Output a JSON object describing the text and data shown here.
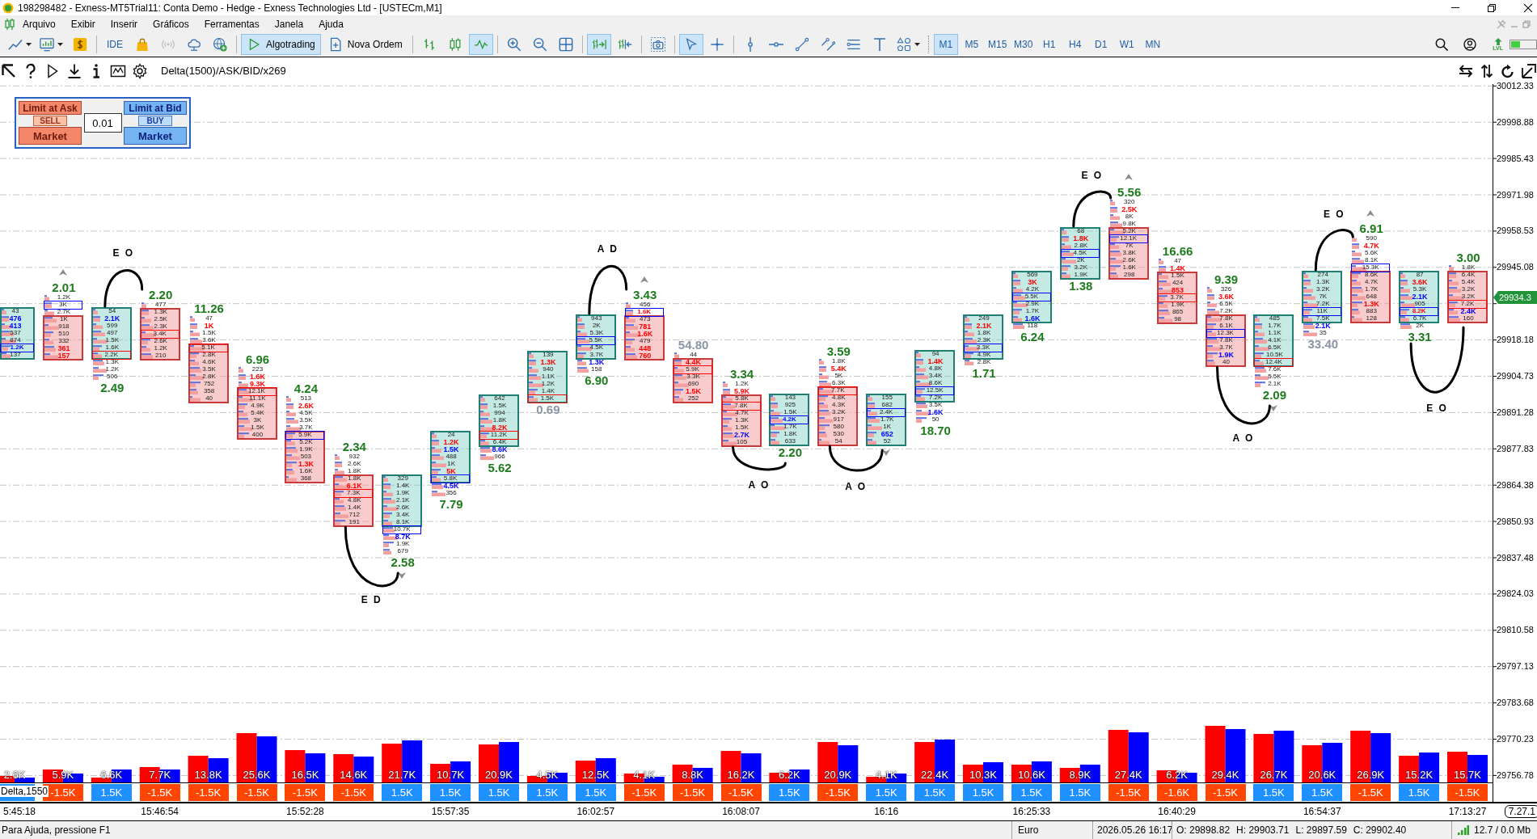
{
  "window": {
    "title": "198298482 - Exness-MT5Trial11: Conta Demo - Hedge - Exness Technologies Ltd - [USTECm,M1]"
  },
  "menu": [
    "Arquivo",
    "Exibir",
    "Inserir",
    "Gráficos",
    "Ferramentas",
    "Janela",
    "Ajuda"
  ],
  "toolbar": {
    "groups": [
      [
        {
          "selected": false
        },
        {
          "selected": false
        },
        {
          "selected": false
        }
      ],
      [
        {
          "label": "IDE",
          "selected": false
        },
        {
          "selected": false
        },
        {
          "selected": false
        },
        {
          "selected": false
        },
        {
          "selected": false
        }
      ],
      [
        {
          "label": "Algotrading",
          "selected": true
        },
        {
          "label": "Nova Ordem",
          "selected": false
        }
      ],
      [
        {
          "selected": false
        },
        {
          "selected": false
        },
        {
          "selected": true
        }
      ],
      [
        {
          "selected": false
        },
        {
          "selected": false
        },
        {
          "selected": false
        }
      ],
      [
        {
          "selected": true
        },
        {
          "selected": false
        }
      ],
      [
        {
          "selected": false
        }
      ],
      [
        {
          "selected": true
        },
        {
          "selected": false
        }
      ],
      [
        {
          "selected": false
        },
        {
          "selected": false
        },
        {
          "selected": false
        },
        {
          "selected": false
        },
        {
          "selected": false
        },
        {
          "selected": false
        },
        {
          "selected": false
        }
      ]
    ],
    "timeframes": [
      {
        "label": "M1",
        "selected": true
      },
      {
        "label": "M5",
        "selected": false
      },
      {
        "label": "M15",
        "selected": false
      },
      {
        "label": "M30",
        "selected": false
      },
      {
        "label": "H1",
        "selected": false
      },
      {
        "label": "H4",
        "selected": false
      },
      {
        "label": "D1",
        "selected": false
      },
      {
        "label": "W1",
        "selected": false
      },
      {
        "label": "MN",
        "selected": false
      }
    ],
    "badge": "LVL"
  },
  "chart": {
    "indicator_label": "Delta(1500)/ASK/BID/x269",
    "trade_panel": {
      "sides": [
        {
          "kind": "sell",
          "limit": "Limit at Ask",
          "action": "SELL",
          "market": "Market"
        },
        {
          "kind": "buy",
          "limit": "Limit at Bid",
          "action": "BUY",
          "market": "Market"
        }
      ],
      "volume": "0.01"
    },
    "price_axis": [
      "30012.33",
      "29998.88",
      "29985.43",
      "29971.98",
      "29958.53",
      "29945.08",
      "29918.18",
      "29904.73",
      "29891.28",
      "29877.83",
      "29864.38",
      "29850.93",
      "29837.48",
      "29824.03",
      "29810.58",
      "29797.13",
      "29783.68",
      "29770.23",
      "29756.78"
    ],
    "current_price": "29934.3",
    "candles": [
      {
        "kind": "bullish",
        "body": [
          {
            "text": "43",
            "kind": "plain"
          },
          {
            "text": "476",
            "kind": "buy"
          },
          {
            "text": "413",
            "kind": "buy"
          },
          {
            "text": "537",
            "kind": "plain"
          },
          {
            "text": "874",
            "kind": "plain"
          },
          {
            "text": "1.2K",
            "kind": "buy",
            "frame": {
              "color": "#0000ff"
            }
          },
          {
            "text": "137",
            "kind": "plain"
          }
        ]
      },
      {
        "kind": "bearish",
        "above": [
          {
            "text": "1.2K",
            "kind": "plain"
          },
          {
            "text": "3K",
            "kind": "plain",
            "frame": {
              "color": "#0000ff"
            }
          },
          {
            "text": "2.7K",
            "kind": "plain"
          }
        ],
        "body": [
          {
            "text": "1K",
            "kind": "plain"
          },
          {
            "text": "918",
            "kind": "plain"
          },
          {
            "text": "510",
            "kind": "plain"
          },
          {
            "text": "332",
            "kind": "plain"
          },
          {
            "text": "361",
            "kind": "sell"
          },
          {
            "text": "157",
            "kind": "sell"
          }
        ],
        "delta": {
          "text": "2.01",
          "color": "#1e7b1e"
        },
        "arrow": {
          "kind": "up"
        }
      },
      {
        "kind": "bullish",
        "body": [
          {
            "text": "54",
            "kind": "plain"
          },
          {
            "text": "2.1K",
            "kind": "buy"
          },
          {
            "text": "599",
            "kind": "plain"
          },
          {
            "text": "497",
            "kind": "plain"
          },
          {
            "text": "1.5K",
            "kind": "plain"
          },
          {
            "text": "1.6K",
            "kind": "plain"
          },
          {
            "text": "2.2K",
            "kind": "plain",
            "frame": {
              "color": "#ff0000"
            }
          }
        ],
        "below": [
          {
            "text": "1.3K",
            "kind": "plain"
          },
          {
            "text": "1.2K",
            "kind": "plain"
          },
          {
            "text": "506",
            "kind": "plain"
          }
        ],
        "delta": {
          "text": "2.49",
          "color": "#1e7b1e"
        },
        "curve": {
          "label": "E O",
          "kind": "above"
        }
      },
      {
        "kind": "bearish",
        "above": [
          {
            "text": "477",
            "kind": "plain"
          }
        ],
        "body": [
          {
            "text": "1.3K",
            "kind": "plain"
          },
          {
            "text": "2.5K",
            "kind": "plain"
          },
          {
            "text": "2.3K",
            "kind": "plain"
          },
          {
            "text": "3.4K",
            "kind": "plain",
            "frame": {
              "color": "#ff0000"
            }
          },
          {
            "text": "2.6K",
            "kind": "plain"
          },
          {
            "text": "1.2K",
            "kind": "plain"
          },
          {
            "text": "210",
            "kind": "plain"
          }
        ],
        "delta": {
          "text": "2.20",
          "color": "#1e7b1e"
        }
      },
      {
        "kind": "bearish",
        "above": [
          {
            "text": "47",
            "kind": "plain"
          },
          {
            "text": "1K",
            "kind": "sell"
          },
          {
            "text": "1.5K",
            "kind": "plain"
          },
          {
            "text": "3.6K",
            "kind": "plain"
          }
        ],
        "body": [
          {
            "text": "5.1K",
            "kind": "plain",
            "frame": {
              "color": "#ff0000"
            }
          },
          {
            "text": "2.8K",
            "kind": "plain"
          },
          {
            "text": "4.6K",
            "kind": "plain"
          },
          {
            "text": "3.5K",
            "kind": "plain"
          },
          {
            "text": "2.8K",
            "kind": "plain"
          },
          {
            "text": "752",
            "kind": "plain"
          },
          {
            "text": "358",
            "kind": "plain"
          },
          {
            "text": "40",
            "kind": "plain"
          }
        ],
        "delta": {
          "text": "11.26",
          "color": "#1e7b1e"
        }
      },
      {
        "kind": "bearish",
        "above": [
          {
            "text": "223",
            "kind": "plain"
          },
          {
            "text": "1.6K",
            "kind": "sell"
          },
          {
            "text": "9.3K",
            "kind": "sell"
          }
        ],
        "body": [
          {
            "text": "12.1K",
            "kind": "plain",
            "frame": {
              "color": "#ff0000"
            }
          },
          {
            "text": "11.1K",
            "kind": "plain"
          },
          {
            "text": "4.9K",
            "kind": "plain"
          },
          {
            "text": "5.4K",
            "kind": "plain"
          },
          {
            "text": "3K",
            "kind": "plain"
          },
          {
            "text": "1.5K",
            "kind": "plain"
          },
          {
            "text": "400",
            "kind": "plain"
          }
        ],
        "delta": {
          "text": "6.96",
          "color": "#1e7b1e"
        }
      },
      {
        "kind": "bearish",
        "above": [
          {
            "text": "513",
            "kind": "plain"
          },
          {
            "text": "2.6K",
            "kind": "sell"
          },
          {
            "text": "4.5K",
            "kind": "plain"
          },
          {
            "text": "3.5K",
            "kind": "plain"
          },
          {
            "text": "3.7K",
            "kind": "plain"
          }
        ],
        "body": [
          {
            "text": "5.9K",
            "kind": "plain",
            "frame": {
              "color": "#0000ff"
            }
          },
          {
            "text": "5.2K",
            "kind": "plain"
          },
          {
            "text": "1.9K",
            "kind": "plain"
          },
          {
            "text": "503",
            "kind": "plain"
          },
          {
            "text": "1.3K",
            "kind": "sell"
          },
          {
            "text": "1.6K",
            "kind": "plain"
          },
          {
            "text": "368",
            "kind": "plain"
          }
        ],
        "delta": {
          "text": "4.24",
          "color": "#1e7b1e"
        }
      },
      {
        "kind": "bearish",
        "above": [
          {
            "text": "932",
            "kind": "plain"
          },
          {
            "text": "2.6K",
            "kind": "plain"
          },
          {
            "text": "1.8K",
            "kind": "plain"
          }
        ],
        "body": [
          {
            "text": "1.8K",
            "kind": "plain"
          },
          {
            "text": "6.1K",
            "kind": "sell"
          },
          {
            "text": "7.3K",
            "kind": "plain",
            "frame": {
              "color": "#ff0000"
            }
          },
          {
            "text": "4.8K",
            "kind": "plain"
          },
          {
            "text": "1.4K",
            "kind": "plain"
          },
          {
            "text": "712",
            "kind": "plain"
          },
          {
            "text": "191",
            "kind": "plain"
          }
        ],
        "delta": {
          "text": "2.34",
          "color": "#1e7b1e"
        },
        "curve": {
          "label": "E D",
          "kind": "below"
        }
      },
      {
        "kind": "bullish",
        "body": [
          {
            "text": "329",
            "kind": "plain"
          },
          {
            "text": "1.4K",
            "kind": "plain"
          },
          {
            "text": "1.9K",
            "kind": "plain"
          },
          {
            "text": "2.1K",
            "kind": "plain"
          },
          {
            "text": "2.6K",
            "kind": "plain"
          },
          {
            "text": "3.4K",
            "kind": "plain"
          },
          {
            "text": "8.1K",
            "kind": "plain"
          }
        ],
        "below": [
          {
            "text": "10.7K",
            "kind": "plain",
            "frame": {
              "color": "#0000ff"
            }
          },
          {
            "text": "8.7K",
            "kind": "buy"
          },
          {
            "text": "1.9K",
            "kind": "plain"
          },
          {
            "text": "679",
            "kind": "plain"
          }
        ],
        "delta": {
          "text": "2.58",
          "color": "#1e7b1e"
        },
        "arrow": {
          "kind": "down"
        }
      },
      {
        "kind": "bullish",
        "body": [
          {
            "text": "24",
            "kind": "plain"
          },
          {
            "text": "1.2K",
            "kind": "sell"
          },
          {
            "text": "1.5K",
            "kind": "buy"
          },
          {
            "text": "488",
            "kind": "plain"
          },
          {
            "text": "1K",
            "kind": "plain"
          },
          {
            "text": "5K",
            "kind": "sell"
          },
          {
            "text": "5.8K",
            "kind": "plain",
            "frame": {
              "color": "#0000ff"
            }
          }
        ],
        "below": [
          {
            "text": "4.5K",
            "kind": "buy"
          },
          {
            "text": "356",
            "kind": "plain"
          }
        ],
        "delta": {
          "text": "7.79",
          "color": "#1e7b1e"
        }
      },
      {
        "kind": "bullish",
        "body": [
          {
            "text": "642",
            "kind": "plain"
          },
          {
            "text": "1.5K",
            "kind": "plain"
          },
          {
            "text": "994",
            "kind": "plain"
          },
          {
            "text": "1.8K",
            "kind": "plain"
          },
          {
            "text": "8.2K",
            "kind": "sell"
          },
          {
            "text": "11.2K",
            "kind": "plain",
            "frame": {
              "color": "#ff0000"
            }
          },
          {
            "text": "6.4K",
            "kind": "plain"
          }
        ],
        "below": [
          {
            "text": "8.6K",
            "kind": "buy"
          },
          {
            "text": "966",
            "kind": "plain"
          }
        ],
        "delta": {
          "text": "5.62",
          "color": "#1e7b1e"
        }
      },
      {
        "kind": "bullish",
        "body": [
          {
            "text": "139",
            "kind": "plain"
          },
          {
            "text": "1.3K",
            "kind": "sell"
          },
          {
            "text": "940",
            "kind": "plain"
          },
          {
            "text": "1.1K",
            "kind": "plain"
          },
          {
            "text": "1.2K",
            "kind": "plain"
          },
          {
            "text": "1.4K",
            "kind": "plain"
          },
          {
            "text": "1.5K",
            "kind": "plain",
            "frame": {
              "color": "#ff0000"
            }
          }
        ],
        "delta": {
          "text": "0.69",
          "color": "#8a95a5"
        }
      },
      {
        "kind": "bullish",
        "body": [
          {
            "text": "943",
            "kind": "plain"
          },
          {
            "text": "2K",
            "kind": "plain"
          },
          {
            "text": "5.3K",
            "kind": "plain"
          },
          {
            "text": "5.5K",
            "kind": "plain",
            "frame": {
              "color": "#0000ff"
            }
          },
          {
            "text": "4.5K",
            "kind": "plain"
          },
          {
            "text": "3.7K",
            "kind": "plain"
          }
        ],
        "below": [
          {
            "text": "1.3K",
            "kind": "buy"
          },
          {
            "text": "158",
            "kind": "plain"
          }
        ],
        "delta": {
          "text": "6.90",
          "color": "#1e7b1e"
        },
        "curve": {
          "label": "A D",
          "kind": "above"
        }
      },
      {
        "kind": "bearish",
        "above": [
          {
            "text": "456",
            "kind": "plain"
          },
          {
            "text": "1.6K",
            "kind": "sell",
            "frame": {
              "color": "#0000ff"
            }
          }
        ],
        "body": [
          {
            "text": "473",
            "kind": "plain"
          },
          {
            "text": "781",
            "kind": "sell"
          },
          {
            "text": "1.6K",
            "kind": "sell"
          },
          {
            "text": "479",
            "kind": "plain"
          },
          {
            "text": "448",
            "kind": "sell"
          },
          {
            "text": "760",
            "kind": "sell"
          }
        ],
        "delta": {
          "text": "3.43",
          "color": "#1e7b1e"
        },
        "arrow": {
          "kind": "up"
        }
      },
      {
        "kind": "bearish",
        "above": [
          {
            "text": "44",
            "kind": "plain"
          }
        ],
        "body": [
          {
            "text": "4.4K",
            "kind": "sell"
          },
          {
            "text": "5.9K",
            "kind": "plain",
            "frame": {
              "color": "#ff0000"
            }
          },
          {
            "text": "3.3K",
            "kind": "plain"
          },
          {
            "text": "690",
            "kind": "plain"
          },
          {
            "text": "1.5K",
            "kind": "sell"
          },
          {
            "text": "252",
            "kind": "plain"
          }
        ],
        "delta": {
          "text": "54.80",
          "color": "#8a95a5"
        }
      },
      {
        "kind": "bearish",
        "above": [
          {
            "text": "1.2K",
            "kind": "plain"
          },
          {
            "text": "5.9K",
            "kind": "sell"
          }
        ],
        "body": [
          {
            "text": "5.8K",
            "kind": "plain"
          },
          {
            "text": "7.8K",
            "kind": "plain",
            "frame": {
              "color": "#ff0000"
            }
          },
          {
            "text": "4.7K",
            "kind": "plain"
          },
          {
            "text": "1.3K",
            "kind": "plain"
          },
          {
            "text": "1.5K",
            "kind": "plain"
          },
          {
            "text": "2.7K",
            "kind": "buy"
          },
          {
            "text": "105",
            "kind": "plain"
          }
        ],
        "delta": {
          "text": "3.34",
          "color": "#1e7b1e"
        },
        "curve": {
          "label": "A O",
          "kind": "below"
        }
      },
      {
        "kind": "bullish",
        "body": [
          {
            "text": "143",
            "kind": "plain"
          },
          {
            "text": "925",
            "kind": "plain"
          },
          {
            "text": "1.5K",
            "kind": "plain"
          },
          {
            "text": "4.2K",
            "kind": "buy",
            "frame": {
              "color": "#0000ff"
            }
          },
          {
            "text": "1.7K",
            "kind": "plain"
          },
          {
            "text": "1.8K",
            "kind": "plain"
          },
          {
            "text": "633",
            "kind": "plain"
          }
        ],
        "delta": {
          "text": "2.20",
          "color": "#1e7b1e"
        }
      },
      {
        "kind": "bearish",
        "above": [
          {
            "text": "1.8K",
            "kind": "plain"
          },
          {
            "text": "5.4K",
            "kind": "sell"
          },
          {
            "text": "5K",
            "kind": "plain"
          },
          {
            "text": "6.3K",
            "kind": "plain"
          }
        ],
        "body": [
          {
            "text": "7.7K",
            "kind": "plain",
            "frame": {
              "color": "#ff0000"
            }
          },
          {
            "text": "4.8K",
            "kind": "plain"
          },
          {
            "text": "4.3K",
            "kind": "plain"
          },
          {
            "text": "3.2K",
            "kind": "plain"
          },
          {
            "text": "917",
            "kind": "plain"
          },
          {
            "text": "580",
            "kind": "plain"
          },
          {
            "text": "530",
            "kind": "plain"
          },
          {
            "text": "54",
            "kind": "plain"
          }
        ],
        "delta": {
          "text": "3.59",
          "color": "#1e7b1e"
        },
        "curve": {
          "label": "A O",
          "kind": "below"
        }
      },
      {
        "kind": "bullish",
        "body": [
          {
            "text": "155",
            "kind": "plain"
          },
          {
            "text": "682",
            "kind": "plain"
          },
          {
            "text": "2.4K",
            "kind": "plain",
            "frame": {
              "color": "#0000ff"
            }
          },
          {
            "text": "1.7K",
            "kind": "plain"
          },
          {
            "text": "1K",
            "kind": "plain"
          },
          {
            "text": "652",
            "kind": "buy"
          },
          {
            "text": "52",
            "kind": "plain"
          }
        ],
        "arrow": {
          "kind": "down"
        }
      },
      {
        "kind": "bullish",
        "body": [
          {
            "text": "94",
            "kind": "plain"
          },
          {
            "text": "1.4K",
            "kind": "sell"
          },
          {
            "text": "4.8K",
            "kind": "plain"
          },
          {
            "text": "3.4K",
            "kind": "plain"
          },
          {
            "text": "8.6K",
            "kind": "plain"
          },
          {
            "text": "12.5K",
            "kind": "plain",
            "frame": {
              "color": "#0000ff"
            }
          },
          {
            "text": "7.2K",
            "kind": "plain"
          }
        ],
        "below": [
          {
            "text": "3.5K",
            "kind": "plain"
          },
          {
            "text": "1.6K",
            "kind": "buy"
          },
          {
            "text": "50",
            "kind": "plain"
          }
        ],
        "delta": {
          "text": "18.70",
          "color": "#1e7b1e"
        }
      },
      {
        "kind": "bullish",
        "body": [
          {
            "text": "249",
            "kind": "plain"
          },
          {
            "text": "2.1K",
            "kind": "sell"
          },
          {
            "text": "1.8K",
            "kind": "plain"
          },
          {
            "text": "2.3K",
            "kind": "plain"
          },
          {
            "text": "3.3K",
            "kind": "plain",
            "frame": {
              "color": "#0000ff"
            }
          },
          {
            "text": "4.9K",
            "kind": "plain"
          }
        ],
        "below": [
          {
            "text": "2.8K",
            "kind": "plain"
          }
        ],
        "delta": {
          "text": "1.71",
          "color": "#1e7b1e"
        }
      },
      {
        "kind": "bullish",
        "body": [
          {
            "text": "569",
            "kind": "plain"
          },
          {
            "text": "3K",
            "kind": "sell"
          },
          {
            "text": "4.2K",
            "kind": "plain"
          },
          {
            "text": "5.5K",
            "kind": "plain",
            "frame": {
              "color": "#0000ff"
            }
          },
          {
            "text": "2.9K",
            "kind": "plain"
          },
          {
            "text": "1.7K",
            "kind": "plain"
          },
          {
            "text": "1.6K",
            "kind": "buy"
          }
        ],
        "below": [
          {
            "text": "118",
            "kind": "plain"
          }
        ],
        "delta": {
          "text": "6.24",
          "color": "#1e7b1e"
        }
      },
      {
        "kind": "bullish",
        "body": [
          {
            "text": "68",
            "kind": "plain"
          },
          {
            "text": "1.8K",
            "kind": "sell"
          },
          {
            "text": "2.8K",
            "kind": "plain"
          },
          {
            "text": "4.5K",
            "kind": "plain",
            "frame": {
              "color": "#0000ff"
            }
          },
          {
            "text": "2K",
            "kind": "plain"
          },
          {
            "text": "3.2K",
            "kind": "plain"
          },
          {
            "text": "1.9K",
            "kind": "plain"
          }
        ],
        "delta": {
          "text": "1.38",
          "color": "#1e7b1e"
        },
        "curve": {
          "label": "E O",
          "kind": "above"
        }
      },
      {
        "kind": "bearish",
        "above": [
          {
            "text": "320",
            "kind": "plain"
          },
          {
            "text": "2.5K",
            "kind": "sell"
          },
          {
            "text": "8K",
            "kind": "plain"
          },
          {
            "text": "9.8K",
            "kind": "plain"
          }
        ],
        "body": [
          {
            "text": "5.2K",
            "kind": "plain"
          },
          {
            "text": "12.1K",
            "kind": "plain",
            "frame": {
              "color": "#0000ff"
            }
          },
          {
            "text": "7K",
            "kind": "plain"
          },
          {
            "text": "3.8K",
            "kind": "plain"
          },
          {
            "text": "2.6K",
            "kind": "plain"
          },
          {
            "text": "1.6K",
            "kind": "plain"
          },
          {
            "text": "298",
            "kind": "plain"
          }
        ],
        "delta": {
          "text": "5.56",
          "color": "#1e7b1e"
        },
        "arrow": {
          "kind": "up"
        }
      },
      {
        "kind": "bearish",
        "above": [
          {
            "text": "47",
            "kind": "plain"
          },
          {
            "text": "1.4K",
            "kind": "sell"
          }
        ],
        "body": [
          {
            "text": "1.5K",
            "kind": "plain"
          },
          {
            "text": "424",
            "kind": "plain"
          },
          {
            "text": "853",
            "kind": "sell"
          },
          {
            "text": "3.7K",
            "kind": "plain",
            "frame": {
              "color": "#ff0000"
            }
          },
          {
            "text": "1.9K",
            "kind": "plain"
          },
          {
            "text": "865",
            "kind": "plain"
          },
          {
            "text": "98",
            "kind": "plain"
          }
        ],
        "delta": {
          "text": "16.66",
          "color": "#1e7b1e"
        }
      },
      {
        "kind": "bearish",
        "above": [
          {
            "text": "326",
            "kind": "plain"
          },
          {
            "text": "3.6K",
            "kind": "sell"
          },
          {
            "text": "6.5K",
            "kind": "plain"
          },
          {
            "text": "7.2K",
            "kind": "plain"
          }
        ],
        "body": [
          {
            "text": "7.8K",
            "kind": "plain"
          },
          {
            "text": "6.1K",
            "kind": "plain"
          },
          {
            "text": "12.3K",
            "kind": "plain",
            "frame": {
              "color": "#0000ff"
            }
          },
          {
            "text": "7.8K",
            "kind": "plain"
          },
          {
            "text": "3.7K",
            "kind": "plain"
          },
          {
            "text": "1.9K",
            "kind": "buy"
          },
          {
            "text": "40",
            "kind": "plain"
          }
        ],
        "delta": {
          "text": "9.39",
          "color": "#1e7b1e"
        },
        "curve": {
          "label": "A O",
          "kind": "below"
        }
      },
      {
        "kind": "bullish",
        "body": [
          {
            "text": "485",
            "kind": "plain"
          },
          {
            "text": "1.7K",
            "kind": "plain"
          },
          {
            "text": "1.1K",
            "kind": "plain"
          },
          {
            "text": "4.1K",
            "kind": "plain"
          },
          {
            "text": "6.5K",
            "kind": "plain"
          },
          {
            "text": "10.5K",
            "kind": "plain"
          },
          {
            "text": "12.4K",
            "kind": "plain",
            "frame": {
              "color": "#ff0000"
            }
          }
        ],
        "below": [
          {
            "text": "7.6K",
            "kind": "plain"
          },
          {
            "text": "5.5K",
            "kind": "plain"
          },
          {
            "text": "2.1K",
            "kind": "plain"
          }
        ],
        "delta": {
          "text": "2.09",
          "color": "#1e7b1e"
        },
        "arrow": {
          "kind": "down"
        }
      },
      {
        "kind": "bullish",
        "body": [
          {
            "text": "274",
            "kind": "plain"
          },
          {
            "text": "1.3K",
            "kind": "plain"
          },
          {
            "text": "3.2K",
            "kind": "plain"
          },
          {
            "text": "7K",
            "kind": "plain"
          },
          {
            "text": "7.2K",
            "kind": "plain"
          },
          {
            "text": "11K",
            "kind": "plain",
            "frame": {
              "color": "#0000ff"
            }
          },
          {
            "text": "7.5K",
            "kind": "plain"
          }
        ],
        "below": [
          {
            "text": "2.1K",
            "kind": "buy"
          },
          {
            "text": "35",
            "kind": "plain"
          }
        ],
        "delta": {
          "text": "33.40",
          "color": "#8a95a5"
        },
        "curve": {
          "label": "E O",
          "kind": "above"
        }
      },
      {
        "kind": "bearish",
        "above": [
          {
            "text": "590",
            "kind": "plain"
          },
          {
            "text": "4.7K",
            "kind": "sell"
          },
          {
            "text": "5.6K",
            "kind": "plain"
          },
          {
            "text": "8.1K",
            "kind": "plain"
          },
          {
            "text": "15.3K",
            "kind": "plain",
            "frame": {
              "color": "#0000ff"
            }
          }
        ],
        "body": [
          {
            "text": "8.6K",
            "kind": "plain"
          },
          {
            "text": "4.7K",
            "kind": "plain"
          },
          {
            "text": "1.7K",
            "kind": "plain"
          },
          {
            "text": "648",
            "kind": "plain"
          },
          {
            "text": "1.3K",
            "kind": "sell"
          },
          {
            "text": "883",
            "kind": "plain"
          },
          {
            "text": "128",
            "kind": "plain"
          }
        ],
        "delta": {
          "text": "6.91",
          "color": "#1e7b1e"
        },
        "arrow": {
          "kind": "up"
        }
      },
      {
        "kind": "bullish",
        "body": [
          {
            "text": "87",
            "kind": "plain"
          },
          {
            "text": "3.6K",
            "kind": "sell"
          },
          {
            "text": "5.3K",
            "kind": "plain"
          },
          {
            "text": "2.1K",
            "kind": "buy"
          },
          {
            "text": "905",
            "kind": "plain"
          },
          {
            "text": "8.2K",
            "kind": "sell",
            "frame": {
              "color": "#0000ff"
            }
          },
          {
            "text": "6.7K",
            "kind": "plain"
          }
        ],
        "below": [
          {
            "text": "2K",
            "kind": "plain"
          }
        ],
        "delta": {
          "text": "3.31",
          "color": "#1e7b1e"
        },
        "curve": {
          "label": "E O",
          "kind": "below"
        }
      },
      {
        "kind": "bearish",
        "above": [
          {
            "text": "1.8K",
            "kind": "plain"
          }
        ],
        "body": [
          {
            "text": "6.4K",
            "kind": "plain"
          },
          {
            "text": "5.4K",
            "kind": "plain"
          },
          {
            "text": "3.2K",
            "kind": "plain"
          },
          {
            "text": "3.2K",
            "kind": "plain"
          },
          {
            "text": "7.2K",
            "kind": "plain",
            "frame": {
              "color": "#ff0000"
            }
          },
          {
            "text": "2.4K",
            "kind": "buy"
          },
          {
            "text": "160",
            "kind": "plain"
          }
        ],
        "delta": {
          "text": "3.00",
          "color": "#1e7b1e"
        }
      }
    ],
    "volume": {
      "label": "Delta,1550",
      "columns": [
        {
          "label": "2.6K",
          "delta": {
            "kind": "positive"
          }
        },
        {
          "label": "5.9K",
          "delta": {
            "text": "-1.5K",
            "kind": "negative"
          }
        },
        {
          "label": "6.6K",
          "delta": {
            "text": "1.5K",
            "kind": "positive"
          }
        },
        {
          "label": "7.7K",
          "delta": {
            "text": "-1.5K",
            "kind": "negative"
          }
        },
        {
          "label": "13.8K",
          "delta": {
            "text": "-1.5K",
            "kind": "negative"
          }
        },
        {
          "label": "25.6K",
          "delta": {
            "text": "-1.5K",
            "kind": "negative"
          }
        },
        {
          "label": "16.5K",
          "delta": {
            "text": "-1.5K",
            "kind": "negative"
          }
        },
        {
          "label": "14.6K",
          "delta": {
            "text": "-1.5K",
            "kind": "negative"
          }
        },
        {
          "label": "21.7K",
          "delta": {
            "text": "1.5K",
            "kind": "positive"
          }
        },
        {
          "label": "10.7K",
          "delta": {
            "text": "1.5K",
            "kind": "positive"
          }
        },
        {
          "label": "20.9K",
          "delta": {
            "text": "1.5K",
            "kind": "positive"
          }
        },
        {
          "label": "4.5K",
          "delta": {
            "text": "1.5K",
            "kind": "positive"
          }
        },
        {
          "label": "12.5K",
          "delta": {
            "text": "1.5K",
            "kind": "positive"
          }
        },
        {
          "label": "4.1K",
          "delta": {
            "text": "-1.5K",
            "kind": "negative"
          }
        },
        {
          "label": "8.8K",
          "delta": {
            "text": "-1.5K",
            "kind": "negative"
          }
        },
        {
          "label": "16.2K",
          "delta": {
            "text": "-1.5K",
            "kind": "negative"
          }
        },
        {
          "label": "6.2K",
          "delta": {
            "text": "1.5K",
            "kind": "positive"
          }
        },
        {
          "label": "20.9K",
          "delta": {
            "text": "-1.5K",
            "kind": "negative"
          }
        },
        {
          "label": "4.1K",
          "delta": {
            "text": "1.5K",
            "kind": "positive"
          }
        },
        {
          "label": "22.4K",
          "delta": {
            "text": "1.5K",
            "kind": "positive"
          }
        },
        {
          "label": "10.3K",
          "delta": {
            "text": "1.5K",
            "kind": "positive"
          }
        },
        {
          "label": "10.6K",
          "delta": {
            "text": "1.5K",
            "kind": "positive"
          }
        },
        {
          "label": "8.9K",
          "delta": {
            "text": "1.5K",
            "kind": "positive"
          }
        },
        {
          "label": "27.4K",
          "delta": {
            "text": "-1.5K",
            "kind": "negative"
          }
        },
        {
          "label": "6.2K",
          "delta": {
            "text": "-1.6K",
            "kind": "negative"
          }
        },
        {
          "label": "29.4K",
          "delta": {
            "text": "-1.5K",
            "kind": "negative"
          }
        },
        {
          "label": "26.7K",
          "delta": {
            "text": "1.5K",
            "kind": "positive"
          }
        },
        {
          "label": "20.6K",
          "delta": {
            "text": "1.5K",
            "kind": "positive"
          }
        },
        {
          "label": "26.9K",
          "delta": {
            "text": "-1.5K",
            "kind": "negative"
          }
        },
        {
          "label": "15.2K",
          "delta": {
            "text": "1.5K",
            "kind": "positive"
          }
        },
        {
          "label": "15.7K",
          "delta": {
            "text": "-1.5K",
            "kind": "negative"
          }
        }
      ]
    },
    "time_axis": [
      "5:45:18",
      "15:46:54",
      "15:52:28",
      "15:57:35",
      "16:02:57",
      "16:08:07",
      "16:16",
      "16:25:33",
      "16:40:29",
      "16:54:37",
      "17:13:27"
    ],
    "time_marker": "7.27.1"
  },
  "status_bar": {
    "help": "Para Ajuda, pressione F1",
    "profile": "Euro",
    "datetime": "2026.05.26 16:17",
    "ohlc": [
      "O: 29898.82",
      "H: 29903.71",
      "L: 29897.59",
      "C: 29902.40"
    ],
    "traffic": "12.7 / 0.0 Mb"
  }
}
